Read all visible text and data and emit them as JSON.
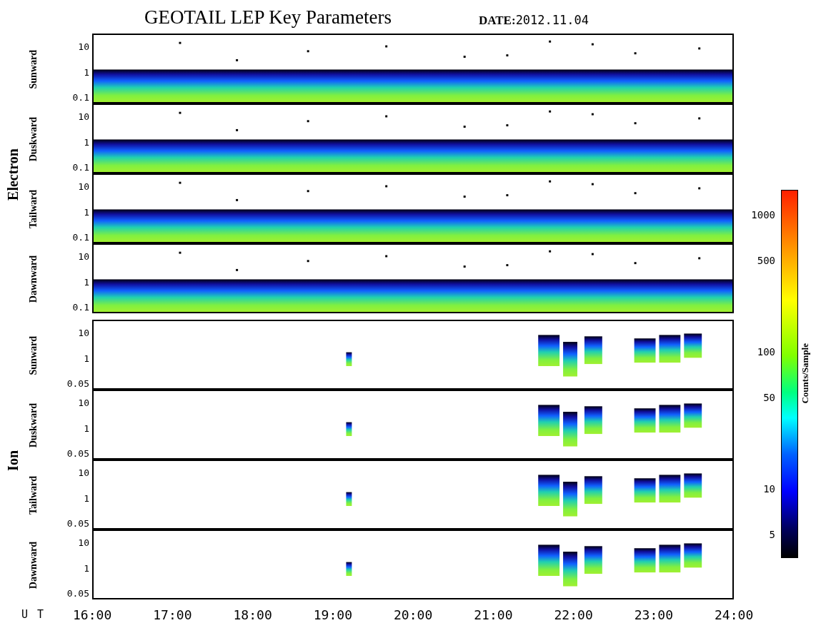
{
  "title": "GEOTAIL LEP Key Parameters",
  "date": {
    "label": "DATE:",
    "value": "2012.11.04"
  },
  "groups": [
    {
      "name": "Electron",
      "kind": "electron",
      "panels": [
        {
          "direction": "Sunward",
          "yticks": [
            "10",
            "1",
            "0.1"
          ]
        },
        {
          "direction": "Duskward",
          "yticks": [
            "10",
            "1",
            "0.1"
          ]
        },
        {
          "direction": "Tailward",
          "yticks": [
            "10",
            "1",
            "0.1"
          ]
        },
        {
          "direction": "Dawnward",
          "yticks": [
            "10",
            "1",
            "0.1"
          ]
        }
      ]
    },
    {
      "name": "Ion",
      "kind": "ion",
      "panels": [
        {
          "direction": "Sunward",
          "yticks": [
            "10",
            "1",
            "0.05"
          ]
        },
        {
          "direction": "Duskward",
          "yticks": [
            "10",
            "1",
            "0.05"
          ]
        },
        {
          "direction": "Tailward",
          "yticks": [
            "10",
            "1",
            "0.05"
          ]
        },
        {
          "direction": "Dawnward",
          "yticks": [
            "10",
            "1",
            "0.05"
          ]
        }
      ]
    }
  ],
  "colorbar": {
    "label": "Counts/Sample",
    "ticks": [
      "1000",
      "500",
      "100",
      "50",
      "10",
      "5"
    ]
  },
  "x_axis": {
    "label": "U T",
    "ticks": [
      "16:00",
      "17:00",
      "18:00",
      "19:00",
      "20:00",
      "21:00",
      "22:00",
      "23:00",
      "24:00"
    ]
  }
}
